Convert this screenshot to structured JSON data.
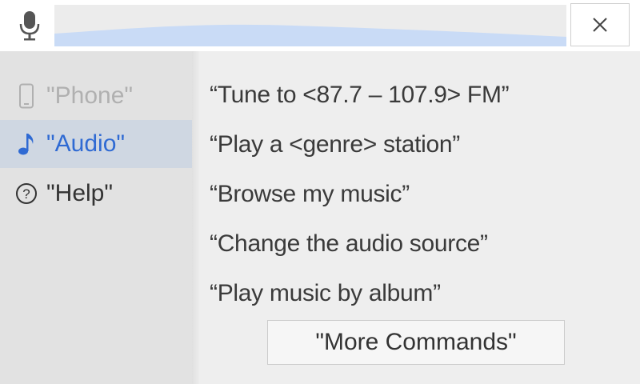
{
  "header": {
    "mic_icon": "microphone-icon",
    "close_icon": "close-icon",
    "wave_color": "#c9dbf6"
  },
  "sidebar": {
    "items": [
      {
        "label": "\"Phone\"",
        "icon": "phone-icon",
        "state": "disabled"
      },
      {
        "label": "\"Audio\"",
        "icon": "music-note-icon",
        "state": "active"
      },
      {
        "label": "\"Help\"",
        "icon": "help-circle-icon",
        "state": "normal"
      }
    ]
  },
  "commands": [
    "“Tune to <87.7 – 107.9> FM”",
    "“Play a <genre> station”",
    "“Browse my music”",
    "“Change the audio source”",
    "“Play music by album”"
  ],
  "more_button": {
    "label": "\"More Commands\""
  },
  "colors": {
    "accent": "#2f6ad3",
    "active_bg": "#cfd7e2",
    "disabled_text": "#b0b0b0"
  }
}
